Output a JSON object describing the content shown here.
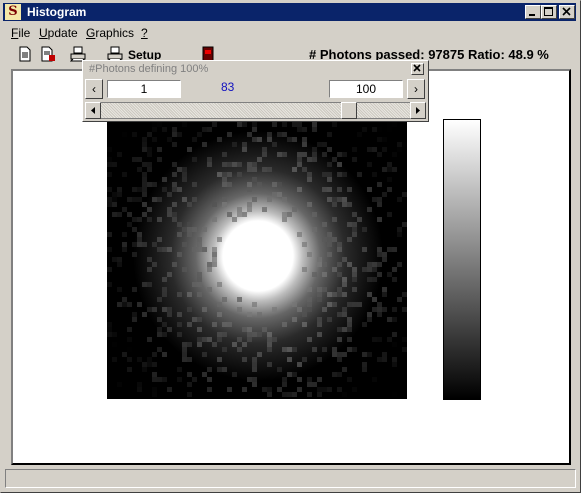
{
  "window": {
    "title": "Histogram",
    "app_icon_letter": "S",
    "buttons": [
      "minimize",
      "maximize",
      "close"
    ]
  },
  "menu": {
    "items": [
      {
        "label": "File",
        "accel": "F"
      },
      {
        "label": "Update",
        "accel": "U"
      },
      {
        "label": "Graphics",
        "accel": "G"
      },
      {
        "label": "?",
        "accel": "?"
      }
    ]
  },
  "toolbar": {
    "icons": [
      "new-document-icon",
      "document-red-icon",
      "print-icon",
      "print-setup-icon",
      "stop-icon"
    ],
    "setup_label": "Setup",
    "photons_label": "# Photons passed: 97875 Ratio: 48.9 %"
  },
  "popup": {
    "title": "#Photons defining 100%",
    "min_value": "1",
    "current_value": "83",
    "max_value": "100",
    "slider_level_fraction": 0.82
  },
  "colors": {
    "titlebar": "#0a246a",
    "value_text": "#1010c0"
  }
}
